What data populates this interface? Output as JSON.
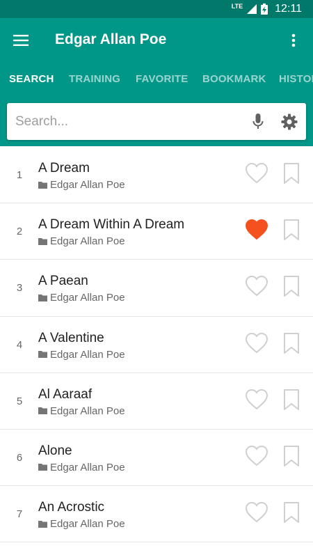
{
  "status_bar": {
    "network": "LTE",
    "time": "12:11"
  },
  "app_bar": {
    "title": "Edgar Allan Poe"
  },
  "tabs": [
    {
      "label": "SEARCH",
      "active": true
    },
    {
      "label": "TRAINING",
      "active": false
    },
    {
      "label": "FAVORITE",
      "active": false
    },
    {
      "label": "BOOKMARK",
      "active": false
    },
    {
      "label": "HISTORY",
      "active": false
    }
  ],
  "search": {
    "placeholder": "Search...",
    "value": ""
  },
  "colors": {
    "primary": "#009688",
    "primary_dark": "#00796b",
    "favorite": "#f4511e",
    "icon_outline": "#cfcfcf"
  },
  "poems": [
    {
      "num": "1",
      "title": "A Dream",
      "author": "Edgar Allan Poe",
      "favorite": false,
      "bookmarked": false
    },
    {
      "num": "2",
      "title": "A Dream Within A Dream",
      "author": "Edgar Allan Poe",
      "favorite": true,
      "bookmarked": false
    },
    {
      "num": "3",
      "title": "A Paean",
      "author": "Edgar Allan Poe",
      "favorite": false,
      "bookmarked": false
    },
    {
      "num": "4",
      "title": "A Valentine",
      "author": "Edgar Allan Poe",
      "favorite": false,
      "bookmarked": false
    },
    {
      "num": "5",
      "title": "Al Aaraaf",
      "author": "Edgar Allan Poe",
      "favorite": false,
      "bookmarked": false
    },
    {
      "num": "6",
      "title": "Alone",
      "author": "Edgar Allan Poe",
      "favorite": false,
      "bookmarked": false
    },
    {
      "num": "7",
      "title": "An Acrostic",
      "author": "Edgar Allan Poe",
      "favorite": false,
      "bookmarked": false
    }
  ]
}
